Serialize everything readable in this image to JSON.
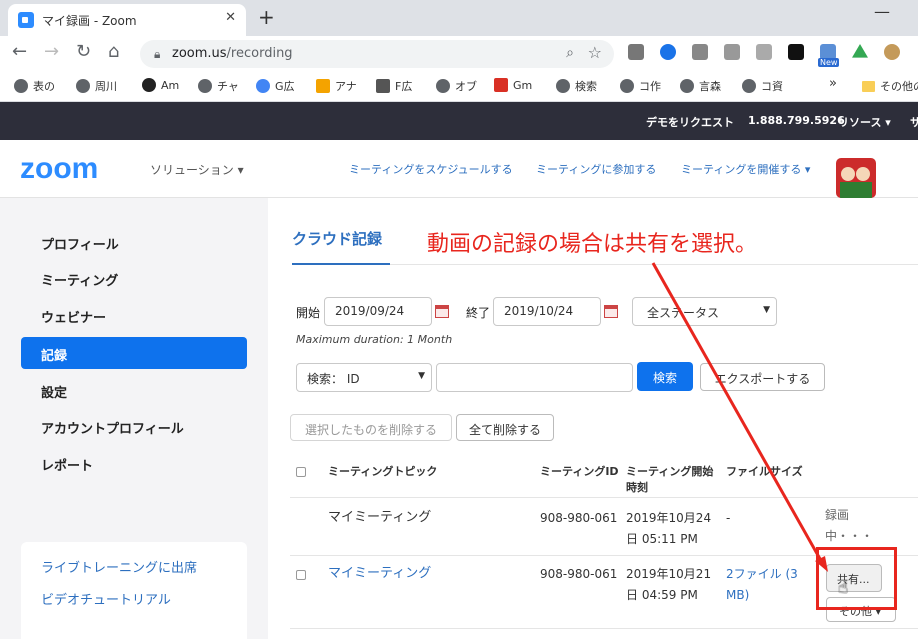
{
  "browser": {
    "tab_title": "マイ録画 - Zoom",
    "tab_close": "✕",
    "new_tab": "+",
    "minimize": "—",
    "url_domain": "zoom.us",
    "url_path": "/recording",
    "ext_new_badge": "New",
    "bookmarks": [
      "表の",
      "周川",
      "Am",
      "チャ",
      "G広",
      "アナ",
      "F広",
      "オブ",
      "Gm",
      "検索",
      "コ作",
      "言森",
      "コ資"
    ],
    "bookmarks_more": "»",
    "bookmarks_other": "その他の"
  },
  "topbar": {
    "demo": "デモをリクエスト",
    "phone": "1.888.799.5926",
    "resources": "リソース ▾",
    "support": "サ"
  },
  "header": {
    "logo": "zoom",
    "solutions": "ソリューション ▾",
    "schedule": "ミーティングをスケジュールする",
    "join": "ミーティングに参加する",
    "host": "ミーティングを開催する ▾"
  },
  "sidebar": {
    "items": [
      "プロフィール",
      "ミーティング",
      "ウェビナー",
      "記録",
      "設定",
      "アカウントプロフィール",
      "レポート"
    ],
    "active_index": 3,
    "links": [
      "ライブトレーニングに出席",
      "ビデオチュートリアル"
    ]
  },
  "main": {
    "tab": "クラウド記録",
    "annotation": "動画の記録の場合は共有を選択。",
    "start_label": "開始",
    "start_date": "2019/09/24",
    "end_label": "終了",
    "end_date": "2019/10/24",
    "status_select": "全ステータス",
    "max_duration": "Maximum duration: 1 Month",
    "search_select": "検索： ID",
    "search_input": "",
    "search_button": "検索",
    "export_button": "エクスポートする",
    "delete_selected": "選択したものを削除する",
    "delete_all": "全て削除する"
  },
  "table": {
    "headers": {
      "topic": "ミーティングトピック",
      "id": "ミーティングID",
      "start_1": "ミーティング開始",
      "start_2": "時刻",
      "size": "ファイルサイズ"
    },
    "rows": [
      {
        "topic": "マイミーティング",
        "id": "908-980-061",
        "time_1": "2019年10月24",
        "time_2": "日 05:11 PM",
        "size_1": "-",
        "size_2": "",
        "status_1": "録画",
        "status_2": "中・・・"
      },
      {
        "topic": "マイミーティング",
        "id": "908-980-061",
        "time_1": "2019年10月21",
        "time_2": "日 04:59 PM",
        "size_1": "2ファイル (3",
        "size_2": "MB)",
        "share": "共有...",
        "other": "その他 ▾"
      }
    ]
  },
  "colors": {
    "accent": "#0e72ed",
    "link": "#2d6fbf",
    "annotation": "#e8261e",
    "topbar": "#2d2e3a"
  }
}
